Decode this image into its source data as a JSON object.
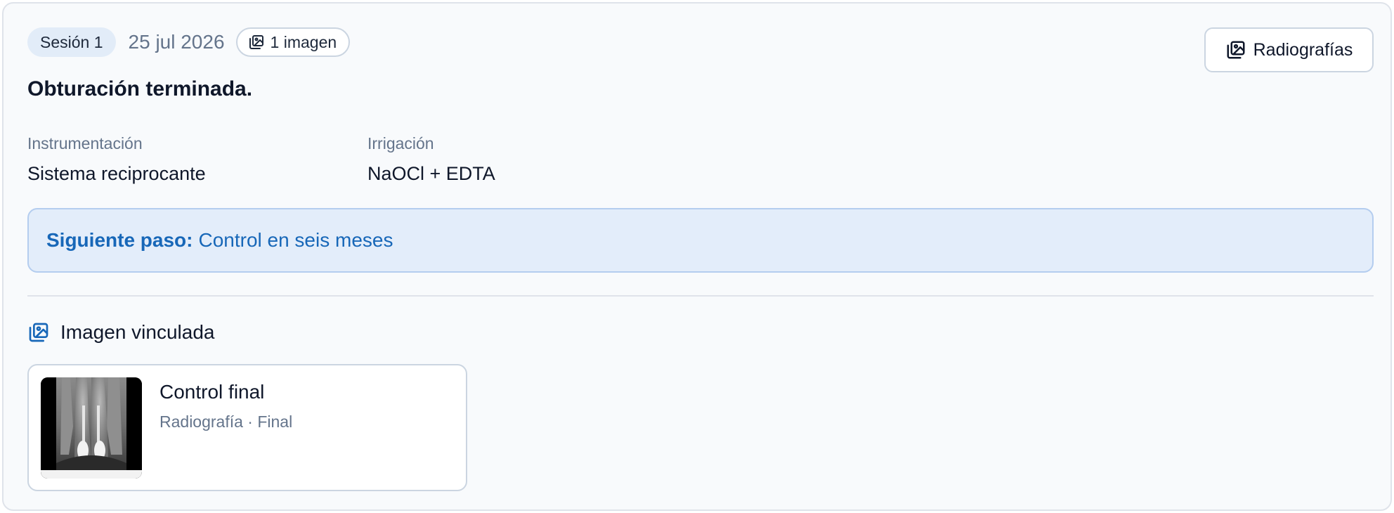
{
  "session": {
    "label": "Sesión 1",
    "date": "25 jul 2026",
    "image_count": "1 imagen",
    "title": "Obturación terminada."
  },
  "actions": {
    "radiografias_label": "Radiografías"
  },
  "fields": [
    {
      "label": "Instrumentación",
      "value": "Sistema reciprocante"
    },
    {
      "label": "Irrigación",
      "value": "NaOCl + EDTA"
    }
  ],
  "next_step": {
    "label": "Siguiente paso:",
    "value": "Control en seis meses"
  },
  "linked_images": {
    "heading": "Imagen vinculada",
    "items": [
      {
        "title": "Control final",
        "subtitle": "Radiografía · Final"
      }
    ]
  },
  "icons": {
    "gallery": "images-icon"
  },
  "colors": {
    "accent": "#1767b8",
    "accent_bg": "#e3edfa",
    "muted_text": "#64748b",
    "border": "#cbd5e1"
  }
}
